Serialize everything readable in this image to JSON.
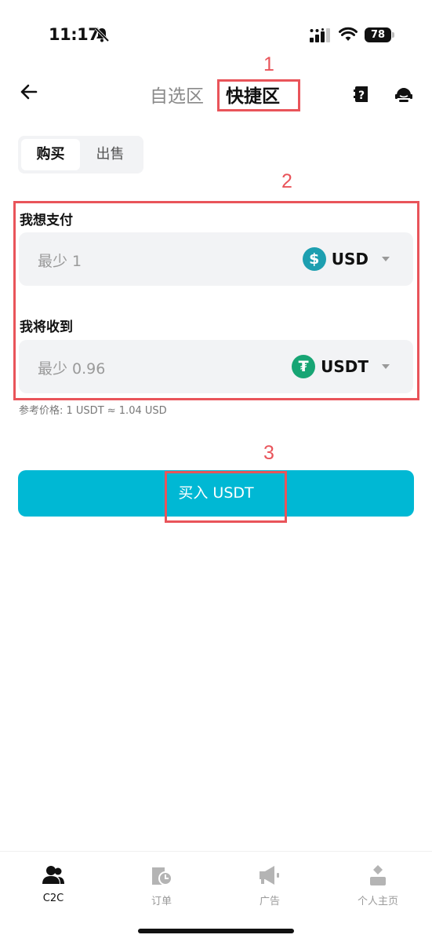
{
  "status_bar": {
    "time": "11:17",
    "battery": "78"
  },
  "header": {
    "tabs": [
      {
        "label": "自选区",
        "active": false
      },
      {
        "label": "快捷区",
        "active": true
      }
    ]
  },
  "annotations": [
    "1",
    "2",
    "3"
  ],
  "trade_toggle": {
    "buy": "购买",
    "sell": "出售",
    "selected": "购买"
  },
  "pay": {
    "label": "我想支付",
    "placeholder": "最少 1",
    "currency": "USD",
    "coin_symbol": "$"
  },
  "receive": {
    "label": "我将收到",
    "placeholder": "最少 0.96",
    "currency": "USDT",
    "coin_symbol": "₮"
  },
  "reference_price": "参考价格: 1 USDT ≈ 1.04 USD",
  "action_button": "买入 USDT",
  "bottom_nav": [
    {
      "label": "C2C",
      "icon": "users-icon",
      "active": true
    },
    {
      "label": "订单",
      "icon": "orders-clock-icon",
      "active": false
    },
    {
      "label": "广告",
      "icon": "megaphone-icon",
      "active": false
    },
    {
      "label": "个人主页",
      "icon": "profile-icon",
      "active": false
    }
  ],
  "colors": {
    "accent": "#00b8d4",
    "annotation": "#e9545a",
    "usd_coin": "#1d9fb0",
    "usdt_coin": "#17a574"
  }
}
